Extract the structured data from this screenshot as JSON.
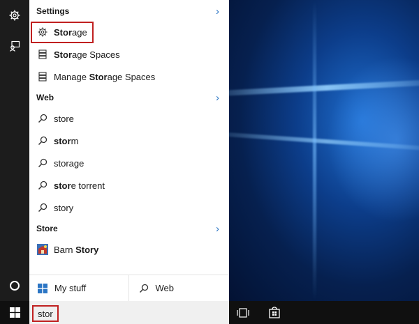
{
  "settings": {
    "title": "Settings",
    "items": [
      {
        "pre": "",
        "bold": "Stor",
        "post": "age",
        "icon": "gear-icon"
      },
      {
        "pre": "",
        "bold": "Stor",
        "post": "age Spaces",
        "icon": "storage-spaces-icon"
      },
      {
        "pre": "Manage ",
        "bold": "Stor",
        "post": "age Spaces",
        "icon": "storage-spaces-icon"
      }
    ]
  },
  "web": {
    "title": "Web",
    "items": [
      {
        "pre": "",
        "bold": "",
        "post": "store",
        "icon": "search-icon"
      },
      {
        "pre": "",
        "bold": "stor",
        "post": "m",
        "icon": "search-icon"
      },
      {
        "pre": "",
        "bold": "",
        "post": "storage",
        "icon": "search-icon"
      },
      {
        "pre": "",
        "bold": "stor",
        "post": "e torrent",
        "icon": "search-icon"
      },
      {
        "pre": "",
        "bold": "",
        "post": "story",
        "icon": "search-icon"
      }
    ]
  },
  "store": {
    "title": "Store",
    "items": [
      {
        "pre": "Barn ",
        "bold": "Story",
        "post": "",
        "icon": "barn-story-app-icon"
      }
    ]
  },
  "tabs": {
    "my_stuff": "My stuff",
    "web": "Web"
  },
  "search": {
    "value": "stor"
  },
  "colors": {
    "accent": "#2b75c4",
    "highlight": "#c02020"
  }
}
